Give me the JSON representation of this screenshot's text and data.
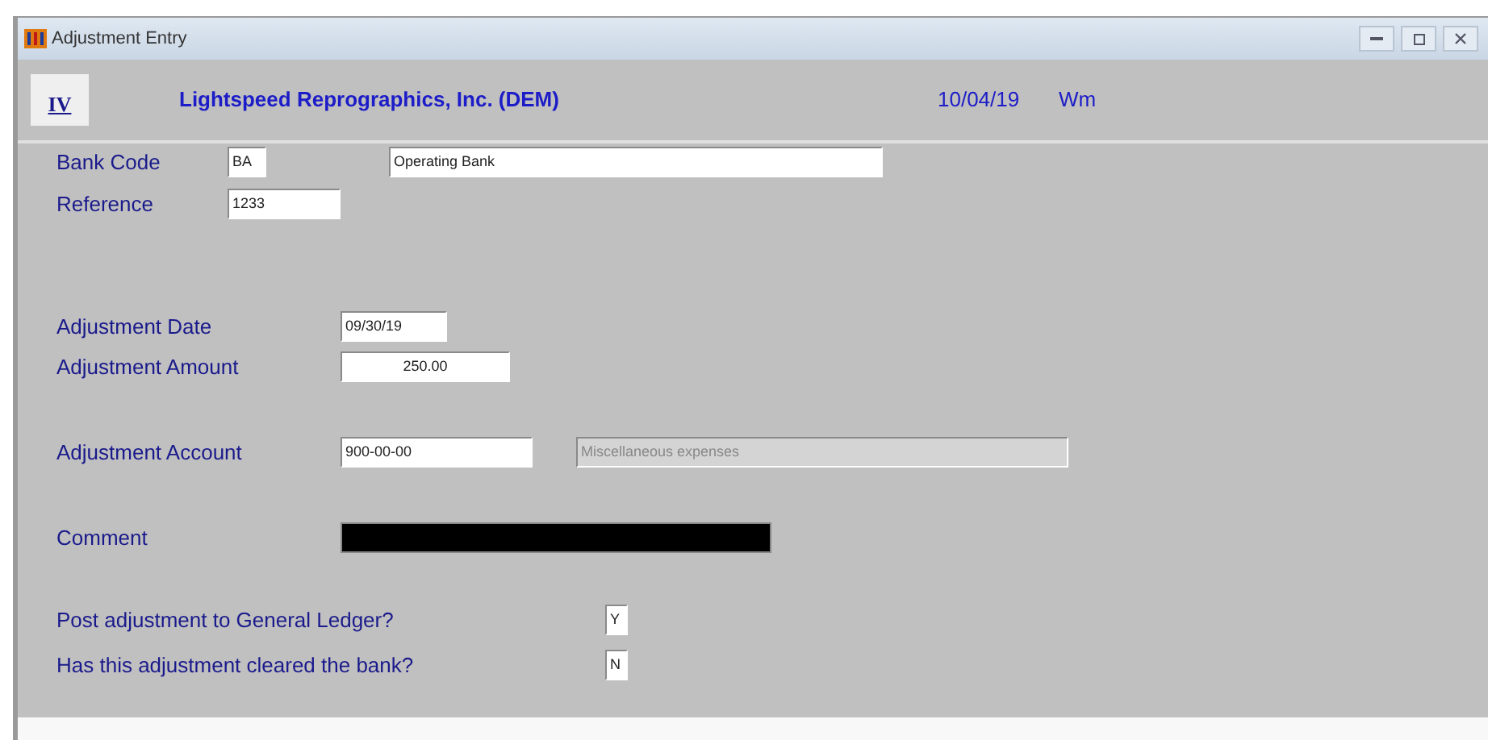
{
  "window": {
    "title": "Adjustment Entry"
  },
  "header": {
    "logo": "IV",
    "company": "Lightspeed Reprographics, Inc. (DEM)",
    "date": "10/04/19",
    "user": "Wm"
  },
  "fields": [
    {
      "label": "Bank Code",
      "value": "BA",
      "description": "Operating Bank",
      "kind": "text"
    },
    {
      "label": "Reference",
      "value": "1233",
      "kind": "text"
    },
    {
      "label": "Adjustment Date",
      "value": "09/30/19",
      "kind": "text"
    },
    {
      "label": "Adjustment Amount",
      "value": "250.00",
      "kind": "amount"
    },
    {
      "label": "Adjustment Account",
      "value": "900-00-00",
      "description": "Miscellaneous expenses",
      "kind": "text"
    },
    {
      "label": "Comment",
      "kind": "selected"
    },
    {
      "label": "Post adjustment to General Ledger?",
      "value": "Y",
      "kind": "flag"
    },
    {
      "label": "Has this adjustment cleared the bank?",
      "value": "N",
      "kind": "flag"
    }
  ]
}
